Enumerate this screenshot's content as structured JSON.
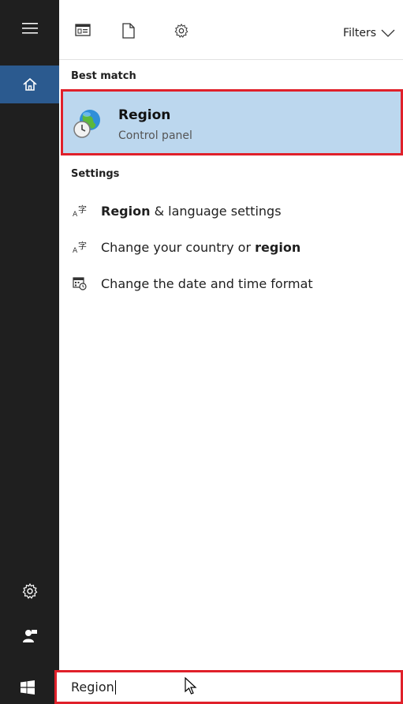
{
  "toolbar": {
    "filters_label": "Filters"
  },
  "best_match": {
    "section_label": "Best match",
    "title": "Region",
    "subtitle": "Control panel"
  },
  "settings": {
    "section_label": "Settings",
    "items": [
      {
        "pre": "",
        "bold": "Region",
        "post": " & language settings",
        "icon": "language-icon"
      },
      {
        "pre": "Change your country or ",
        "bold": "region",
        "post": "",
        "icon": "language-icon"
      },
      {
        "pre": "Change the date and time format",
        "bold": "",
        "post": "",
        "icon": "calendar-clock-icon"
      }
    ]
  },
  "search": {
    "value": "Region"
  },
  "colors": {
    "rail_bg": "#1f1f1f",
    "active_home": "#2b5a8f",
    "highlight_bg": "#bcd7ee",
    "highlight_border": "#e0202a"
  }
}
